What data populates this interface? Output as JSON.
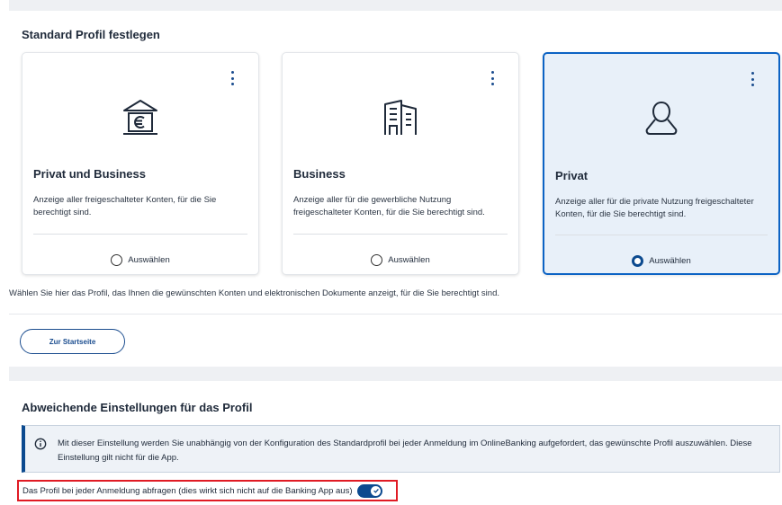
{
  "section1": {
    "title": "Standard Profil festlegen",
    "hint": "Wählen Sie hier das Profil, das Ihnen die gewünschten Konten und elektronischen Dokumente anzeigt, für die Sie berechtigt sind."
  },
  "cards": [
    {
      "title": "Privat und Business",
      "description": "Anzeige aller freigeschalteter Konten, für die Sie berechtigt sind.",
      "select_label": "Auswählen",
      "icon": "bank-euro-icon",
      "selected": false
    },
    {
      "title": "Business",
      "description": "Anzeige aller für die gewerbliche Nutzung freigeschalteter Konten, für die Sie berechtigt sind.",
      "select_label": "Auswählen",
      "icon": "office-building-icon",
      "selected": false
    },
    {
      "title": "Privat",
      "description": "Anzeige aller für die private Nutzung freigeschalteter Konten, für die Sie berechtigt sind.",
      "select_label": "Auswählen",
      "icon": "person-icon",
      "selected": true
    }
  ],
  "home_button": {
    "label": "Zur Startseite"
  },
  "section2": {
    "title": "Abweichende Einstellungen für das Profil",
    "info_text": "Mit dieser Einstellung werden Sie unabhängig von der Konfiguration des Standardprofil bei jeder Anmeldung im OnlineBanking aufgefordert, das gewünschte Profil auszuwählen. Diese Einstellung gilt nicht für die App.",
    "toggle_label": "Das Profil bei jeder Anmeldung abfragen (dies wirkt sich nicht auf die Banking App aus)",
    "toggle_on": true
  },
  "colors": {
    "accent": "#0c4a8f",
    "selected_card_bg": "#e8f0f9",
    "highlight_border": "#e01b24"
  }
}
